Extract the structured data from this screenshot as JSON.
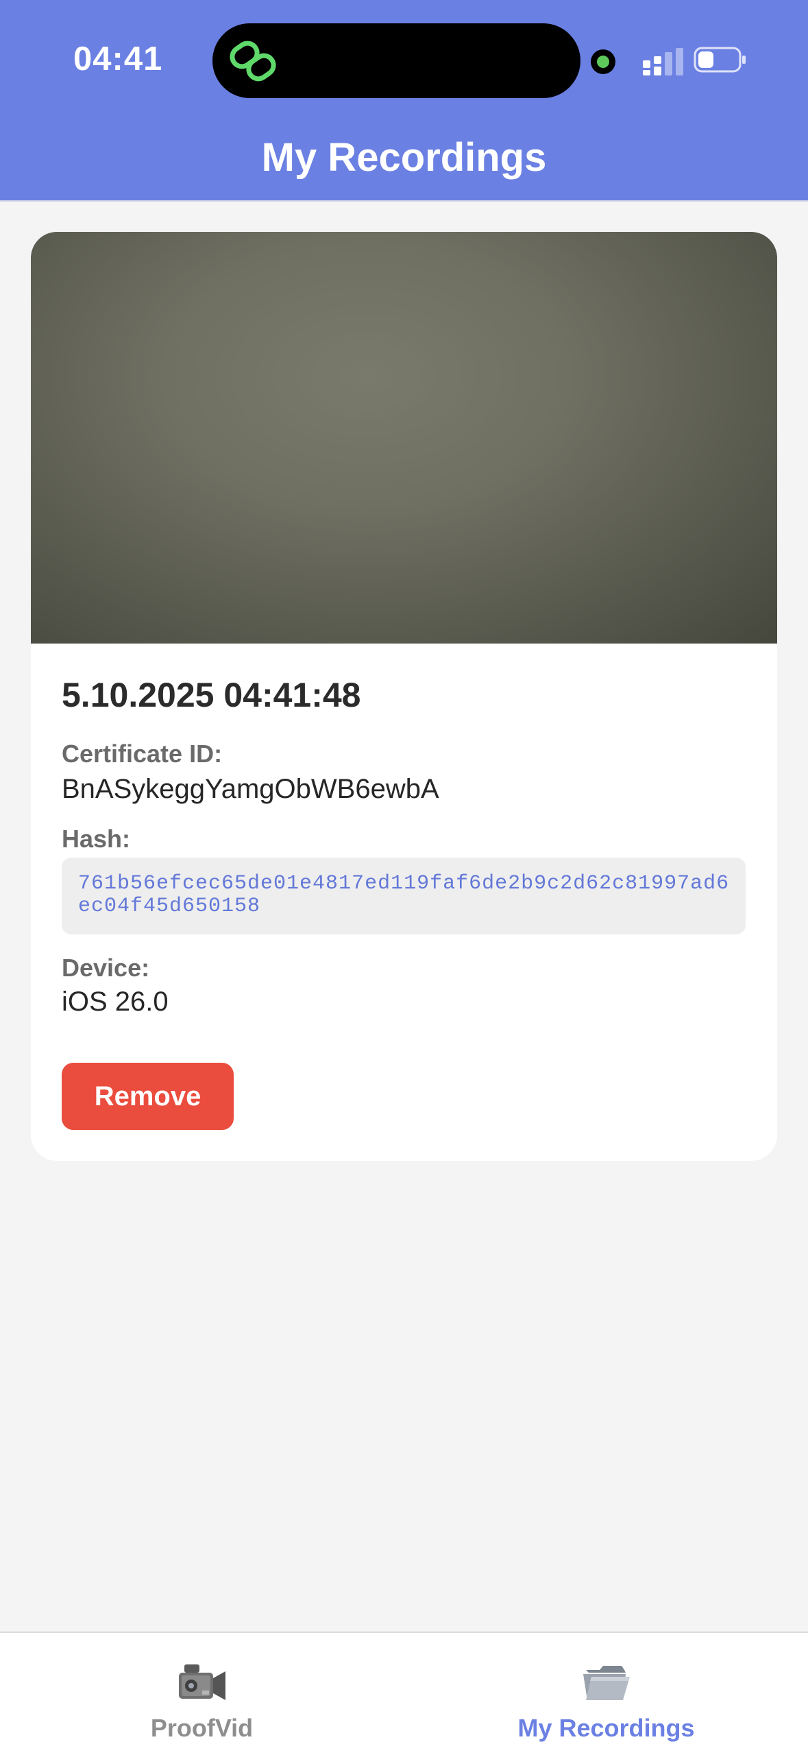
{
  "status_bar": {
    "time": "04:41"
  },
  "header": {
    "title": "My Recordings"
  },
  "recording": {
    "datetime": "5.10.2025 04:41:48",
    "certificate_label": "Certificate ID:",
    "certificate_id": "BnASykeggYamgObWB6ewbA",
    "hash_label": "Hash:",
    "hash": "761b56efcec65de01e4817ed119faf6de2b9c2d62c81997ad6ec04f45d650158",
    "device_label": "Device:",
    "device": "iOS 26.0",
    "remove_label": "Remove"
  },
  "tabs": [
    {
      "label": "ProofVid",
      "icon": "video-camera-icon",
      "active": false
    },
    {
      "label": "My Recordings",
      "icon": "folder-icon",
      "active": true
    }
  ],
  "colors": {
    "header": "#6b80e3",
    "accent": "#6b80e3",
    "danger": "#ea4c3e",
    "tab_inactive": "#8e8e8e",
    "hash_text": "#6378d8"
  }
}
